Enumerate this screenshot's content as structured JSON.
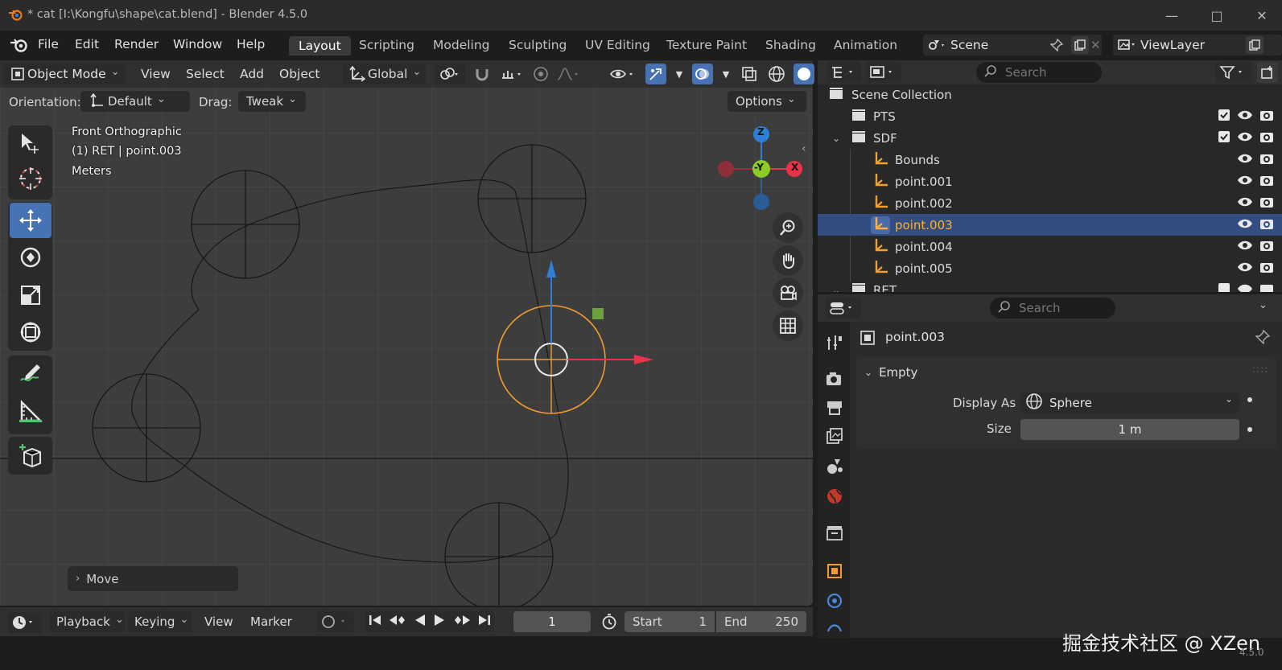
{
  "window": {
    "title": "* cat [I:\\Kongfu\\shape\\cat.blend] - Blender 4.5.0",
    "minimize_icon": "minimize-icon",
    "maximize_icon": "maximize-icon",
    "close_icon": "close-icon"
  },
  "menu": {
    "items": [
      "File",
      "Edit",
      "Render",
      "Window",
      "Help"
    ]
  },
  "workspaces": {
    "tabs": [
      "Layout",
      "Scripting",
      "Modeling",
      "Sculpting",
      "UV Editing",
      "Texture Paint",
      "Shading",
      "Animation"
    ],
    "active": "Layout"
  },
  "scene": {
    "name": "Scene",
    "view_layer": "ViewLayer"
  },
  "viewport_header": {
    "mode": "Object Mode",
    "menus": [
      "View",
      "Select",
      "Add",
      "Object"
    ],
    "transform_orientation": "Global"
  },
  "tool_header": {
    "orientation_label": "Orientation:",
    "orientation_value": "Default",
    "drag_label": "Drag:",
    "drag_value": "Tweak",
    "options": "Options"
  },
  "viewport_info": {
    "view": "Front Orthographic",
    "object": "(1) RET | point.003",
    "units": "Meters"
  },
  "gizmo": {
    "z": "Z",
    "y": "-Y",
    "x": "X"
  },
  "last_operator": "Move",
  "timeline": {
    "menus": [
      "Playback",
      "Keying",
      "View",
      "Marker"
    ],
    "current_frame": "1",
    "start_label": "Start",
    "start": "1",
    "end_label": "End",
    "end": "250"
  },
  "outliner": {
    "search_placeholder": "Search",
    "root": "Scene Collection",
    "rows": [
      {
        "label": "PTS",
        "type": "collection"
      },
      {
        "label": "SDF",
        "type": "collection"
      },
      {
        "label": "Bounds",
        "type": "empty"
      },
      {
        "label": "point.001",
        "type": "empty"
      },
      {
        "label": "point.002",
        "type": "empty"
      },
      {
        "label": "point.003",
        "type": "empty",
        "selected": true
      },
      {
        "label": "point.004",
        "type": "empty"
      },
      {
        "label": "point.005",
        "type": "empty"
      },
      {
        "label": "RET",
        "type": "collection"
      }
    ]
  },
  "properties": {
    "search_placeholder": "Search",
    "object_name": "point.003",
    "panel": "Empty",
    "display_as_label": "Display As",
    "display_as_value": "Sphere",
    "size_label": "Size",
    "size_value": "1 m"
  },
  "watermark": "掘金技术社区 @ XZen",
  "version": "4.5.0",
  "colors": {
    "accent": "#4772b3",
    "selected_text": "#ffaf29",
    "axis_x": "#e8334a",
    "axis_y": "#8ccc25",
    "axis_z": "#2e7fd8",
    "selection_orange": "#f29a2e"
  }
}
